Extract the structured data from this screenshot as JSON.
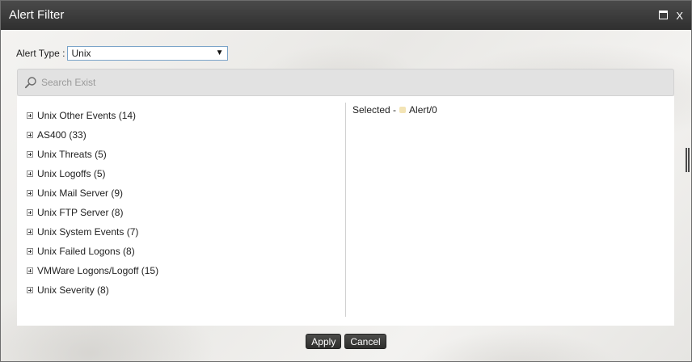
{
  "window": {
    "title": "Alert Filter",
    "maximize_label": "",
    "close_label": "X"
  },
  "alert_type": {
    "label": "Alert Type :",
    "selected": "Unix",
    "arrow": "▼"
  },
  "search": {
    "placeholder": "Search Exist"
  },
  "tree": {
    "items": [
      {
        "label": "Unix Other Events (14)"
      },
      {
        "label": "AS400 (33)"
      },
      {
        "label": "Unix Threats (5)"
      },
      {
        "label": "Unix Logoffs (5)"
      },
      {
        "label": "Unix Mail Server (9)"
      },
      {
        "label": "Unix FTP Server (8)"
      },
      {
        "label": "Unix System Events (7)"
      },
      {
        "label": "Unix Failed Logons (8)"
      },
      {
        "label": "VMWare Logons/Logoff (15)"
      },
      {
        "label": "Unix Severity (8)"
      }
    ]
  },
  "selected": {
    "prefix": "Selected -",
    "value": "Alert/0",
    "dot_color": "#f3e4b5"
  },
  "footer": {
    "apply_label": "Apply",
    "cancel_label": "Cancel"
  },
  "colors": {
    "titlebar": "#3a3a3a",
    "button": "#3a3a38",
    "select_border": "#7aa3c8"
  }
}
